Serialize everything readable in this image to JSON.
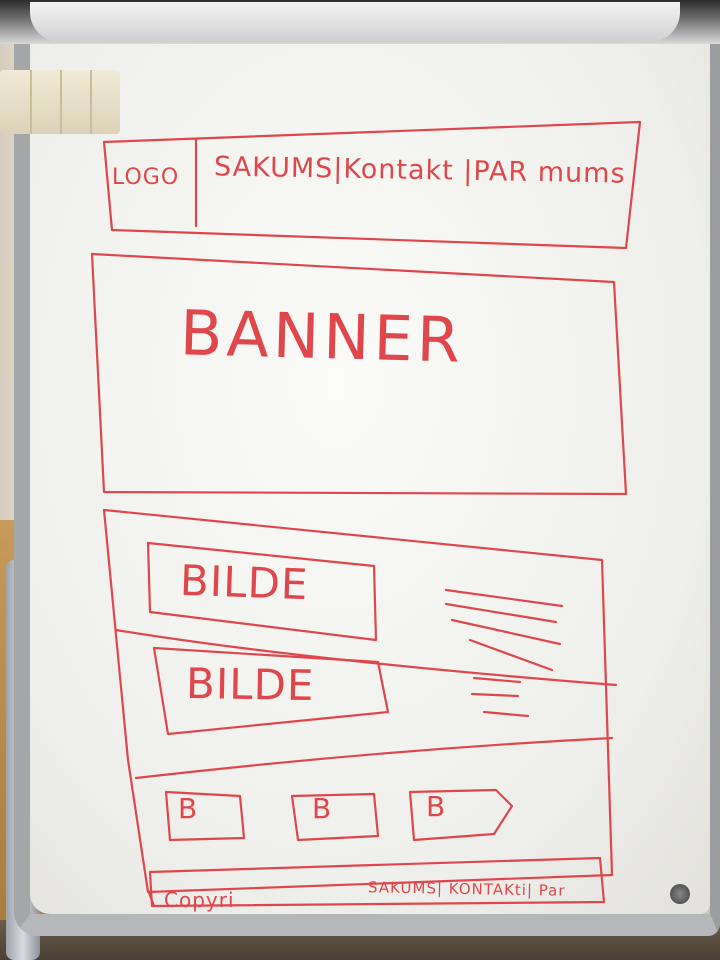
{
  "sketch": {
    "header": {
      "logo": "LOGO",
      "nav": "SAKUMS|Kontakt |PAR mums"
    },
    "banner": "BANNER",
    "content": {
      "image_1": "BILDE",
      "image_2": "BILDE"
    },
    "thumbnails": [
      "B",
      "B",
      "B"
    ],
    "footer": {
      "copyright": "Copyri",
      "nav": "SAKUMS| KONTAKti| Par"
    }
  }
}
